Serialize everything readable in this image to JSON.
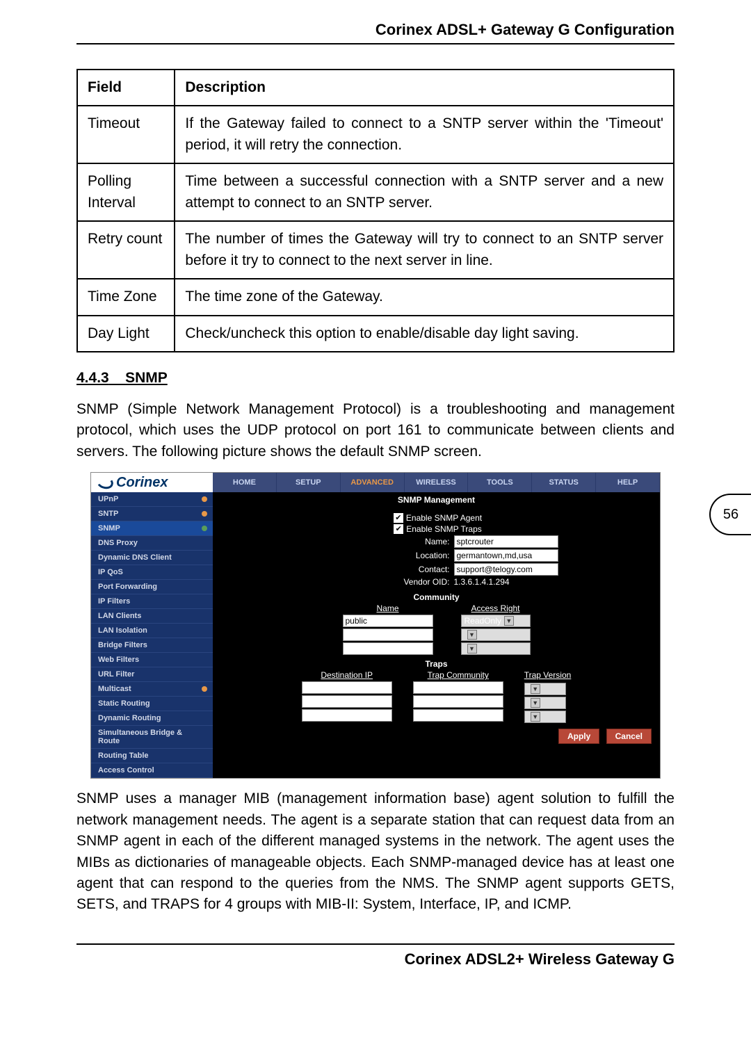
{
  "header": {
    "title": "Corinex ADSL+ Gateway G Configuration"
  },
  "table": {
    "headers": {
      "field": "Field",
      "description": "Description"
    },
    "rows": [
      {
        "field": "Timeout",
        "description": "If the Gateway failed to connect to a SNTP server within the 'Timeout' period, it will retry the connection."
      },
      {
        "field": "Polling Interval",
        "description": "Time between a successful connection with a SNTP server and a new attempt to connect to an SNTP server."
      },
      {
        "field": "Retry count",
        "description": "The number of times the Gateway will try to connect to an SNTP server before it try to connect to the next server in line."
      },
      {
        "field": "Time Zone",
        "description": "The time zone of the Gateway."
      },
      {
        "field": "Day Light",
        "description": "Check/uncheck this option to enable/disable day light saving."
      }
    ]
  },
  "section": {
    "number": "4.4.3",
    "title": "SNMP",
    "intro": "SNMP (Simple Network Management Protocol) is a troubleshooting and management protocol, which uses the UDP protocol on port 161 to communicate between clients and servers. The following picture shows the default SNMP screen.",
    "outro": "SNMP uses a manager MIB (management information base) agent solution to fulfill the network management needs. The agent is a separate station that can request data from an SNMP agent in each of the different managed systems in the network. The agent uses the MIBs as dictionaries of manageable objects. Each SNMP-managed device has at least one agent that can respond to the queries from the NMS. The SNMP agent supports GETS, SETS, and TRAPS for 4 groups with MIB-II: System, Interface, IP, and ICMP."
  },
  "router": {
    "brand": "Corinex",
    "tabs": [
      "HOME",
      "SETUP",
      "ADVANCED",
      "WIRELESS",
      "TOOLS",
      "STATUS",
      "HELP"
    ],
    "activeTab": "ADVANCED",
    "sidebar": [
      "UPnP",
      "SNTP",
      "SNMP",
      "DNS Proxy",
      "Dynamic DNS Client",
      "IP QoS",
      "Port Forwarding",
      "IP Filters",
      "LAN Clients",
      "LAN Isolation",
      "Bridge Filters",
      "Web Filters",
      "URL Filter",
      "Multicast",
      "Static Routing",
      "Dynamic Routing",
      "Simultaneous Bridge & Route",
      "Routing Table",
      "Access Control"
    ],
    "content": {
      "title": "SNMP Management",
      "enable_agent": "Enable SNMP Agent",
      "enable_traps": "Enable SNMP Traps",
      "name_label": "Name:",
      "name_value": "sptcrouter",
      "location_label": "Location:",
      "location_value": "germantown,md,usa",
      "contact_label": "Contact:",
      "contact_value": "support@telogy.com",
      "vendor_label": "Vendor OID:",
      "vendor_value": "1.3.6.1.4.1.294",
      "community_title": "Community",
      "community_name_head": "Name",
      "community_access_head": "Access Right",
      "community_name_value": "public",
      "community_access_value": "ReadOnly",
      "traps_title": "Traps",
      "traps_dest_head": "Destination IP",
      "traps_comm_head": "Trap Community",
      "traps_ver_head": "Trap Version",
      "apply": "Apply",
      "cancel": "Cancel"
    }
  },
  "page_number": "56",
  "footer": {
    "title": "Corinex ADSL2+ Wireless Gateway G"
  }
}
